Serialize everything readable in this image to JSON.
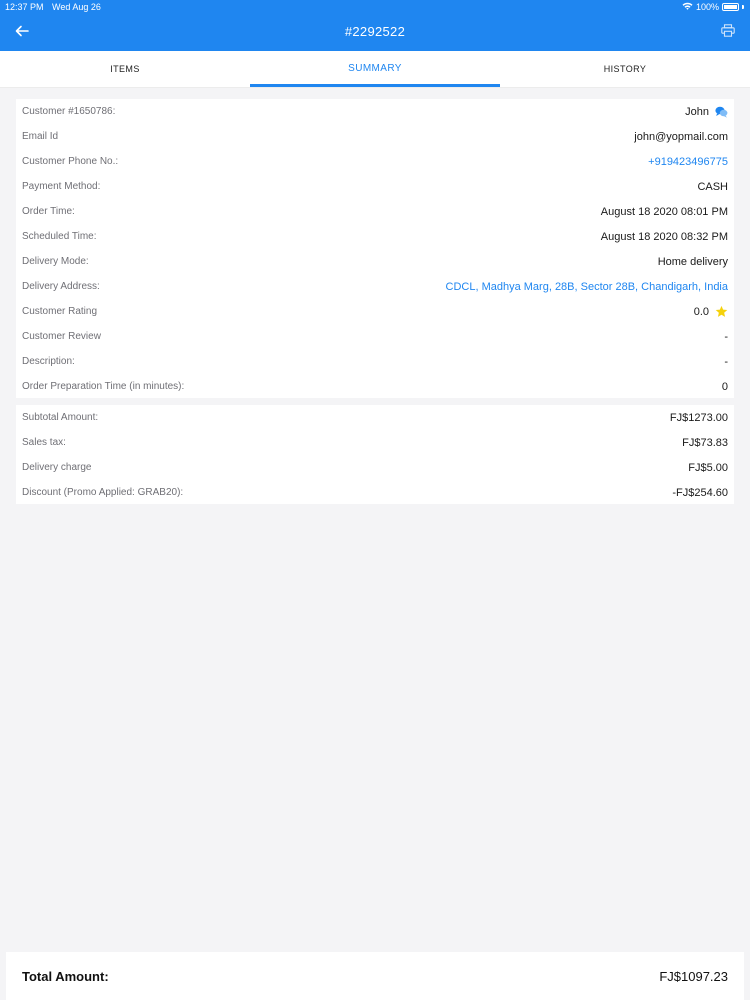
{
  "status_bar": {
    "time": "12:37 PM",
    "date": "Wed Aug 26",
    "battery": "100%"
  },
  "header": {
    "title": "#2292522"
  },
  "tabs": [
    {
      "label": "ITEMS",
      "active": false
    },
    {
      "label": "SUMMARY",
      "active": true
    },
    {
      "label": "HISTORY",
      "active": false
    }
  ],
  "details": [
    {
      "label": "Customer #1650786:",
      "value": "John",
      "type": "chat"
    },
    {
      "label": "Email Id",
      "value": "john@yopmail.com",
      "type": "text"
    },
    {
      "label": "Customer Phone No.:",
      "value": "+919423496775",
      "type": "link"
    },
    {
      "label": "Payment Method:",
      "value": "CASH",
      "type": "text"
    },
    {
      "label": "Order Time:",
      "value": "August 18 2020 08:01 PM",
      "type": "text"
    },
    {
      "label": "Scheduled Time:",
      "value": "August 18 2020 08:32 PM",
      "type": "text"
    },
    {
      "label": "Delivery Mode:",
      "value": "Home delivery",
      "type": "text"
    },
    {
      "label": "Delivery Address:",
      "value": "CDCL, Madhya Marg, 28B, Sector 28B, Chandigarh, India",
      "type": "link"
    },
    {
      "label": "Customer Rating",
      "value": "0.0",
      "type": "rating"
    },
    {
      "label": "Customer Review",
      "value": "-",
      "type": "text"
    },
    {
      "label": "Description:",
      "value": "-",
      "type": "text"
    },
    {
      "label": "Order Preparation Time (in minutes):",
      "value": "0",
      "type": "text"
    }
  ],
  "totals": [
    {
      "label": "Subtotal Amount:",
      "value": "FJ$1273.00"
    },
    {
      "label": "Sales tax:",
      "value": "FJ$73.83"
    },
    {
      "label": "Delivery charge",
      "value": "FJ$5.00"
    },
    {
      "label": "Discount (Promo Applied: GRAB20):",
      "value": "-FJ$254.60"
    }
  ],
  "total": {
    "label": "Total Amount:",
    "value": "FJ$1097.23"
  },
  "colors": {
    "accent": "#1f86f0",
    "star": "#f5d20c",
    "background": "#f4f4f6"
  },
  "icons": {
    "back": "arrow-left-icon",
    "print": "printer-icon",
    "chat": "chat-bubbles-icon",
    "rating": "star-icon",
    "wifi": "wifi-icon",
    "battery": "battery-icon"
  }
}
